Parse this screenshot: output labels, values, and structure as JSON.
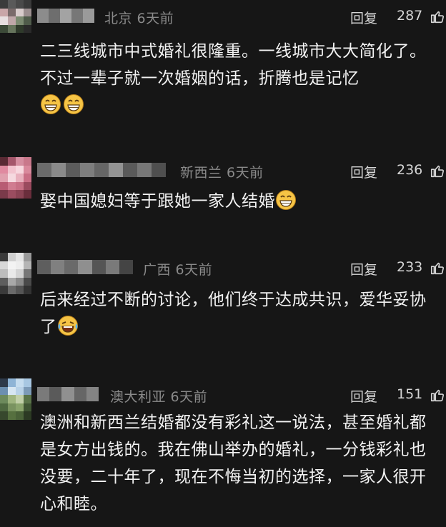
{
  "comments": [
    {
      "location_time": "北京  6天前",
      "reply_label": "回复",
      "likes": "287",
      "text": "二三线城市中式婚礼很隆重。一线城市大大简化了。不过一辈子就一次婚姻的话，折腾也是记忆",
      "emojis": [
        "grin-emoji",
        "grin-emoji"
      ]
    },
    {
      "location_time": "新西兰  6天前",
      "reply_label": "回复",
      "likes": "236",
      "text": "娶中国媳妇等于跟她一家人结婚",
      "emojis": [
        "grin-emoji"
      ]
    },
    {
      "location_time": "广西  6天前",
      "reply_label": "回复",
      "likes": "233",
      "text": "后来经过不断的讨论，他们终于达成共识，爱华妥协了",
      "emojis": [
        "laugh-cry-emoji"
      ]
    },
    {
      "location_time": "澳大利亚  6天前",
      "reply_label": "回复",
      "likes": "151",
      "text": "澳洲和新西兰结婚都没有彩礼这一说法，甚至婚礼都是女方出钱的。我在佛山举办的婚礼，一分钱彩礼也没要，二十年了，现在不悔当初的选择，一家人很开心和睦。",
      "emojis": []
    }
  ],
  "colors": {
    "background": "#161616",
    "text": "#f2f2f2",
    "meta": "#8a8a8a",
    "emoji_face": "#f6c445"
  }
}
